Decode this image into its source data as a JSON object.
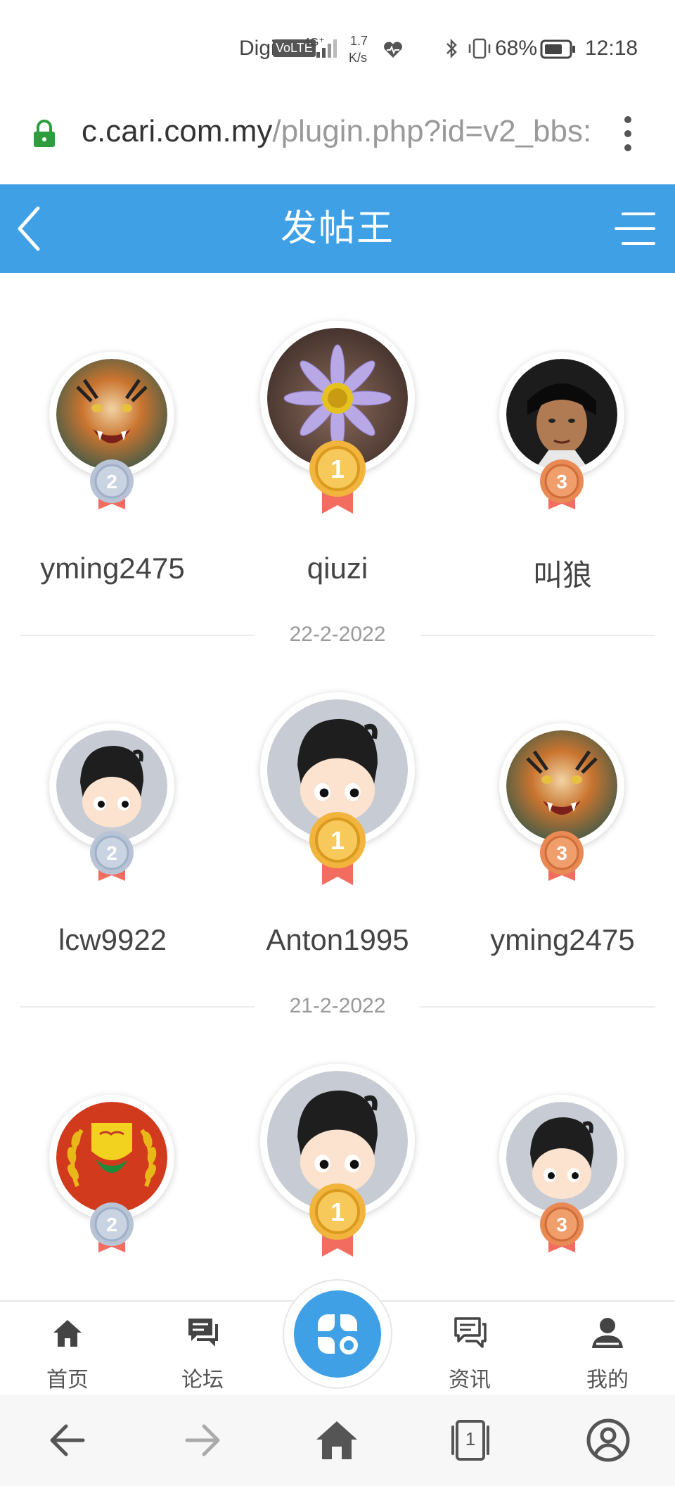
{
  "status_bar": {
    "carrier": "Digi",
    "volte": "VoLTE",
    "network": "4G⁺",
    "speed_value": "1.7",
    "speed_unit": "K/s",
    "battery": "68%",
    "time": "12:18"
  },
  "url_bar": {
    "host": "c.cari.com.my",
    "path": "/plugin.php?id=v2_bbs:"
  },
  "header": {
    "title": "发帖王"
  },
  "podiums": [
    {
      "date": "",
      "first": {
        "name": "qiuzi",
        "rank": "1"
      },
      "second": {
        "name": "yming2475",
        "rank": "2"
      },
      "third": {
        "name": "叫狼",
        "rank": "3"
      }
    },
    {
      "date": "22-2-2022",
      "first": {
        "name": "Anton1995",
        "rank": "1"
      },
      "second": {
        "name": "lcw9922",
        "rank": "2"
      },
      "third": {
        "name": "yming2475",
        "rank": "3"
      }
    },
    {
      "date": "21-2-2022",
      "first": {
        "name": "",
        "rank": "1"
      },
      "second": {
        "name": "",
        "rank": "2"
      },
      "third": {
        "name": "",
        "rank": "3"
      }
    }
  ],
  "app_nav": {
    "items": [
      {
        "label": "首页",
        "icon": "home-icon"
      },
      {
        "label": "论坛",
        "icon": "forum-icon"
      },
      {
        "label": "资讯",
        "icon": "news-icon"
      },
      {
        "label": "我的",
        "icon": "profile-icon"
      }
    ],
    "center_icon": "apps-icon"
  },
  "browser_nav": {
    "tab_count": "1"
  },
  "colors": {
    "primary": "#3fa0e6",
    "gold": "#f2b43c",
    "silver": "#b8c4d6",
    "bronze": "#e98a55",
    "ribbon": "#f26d5f"
  }
}
